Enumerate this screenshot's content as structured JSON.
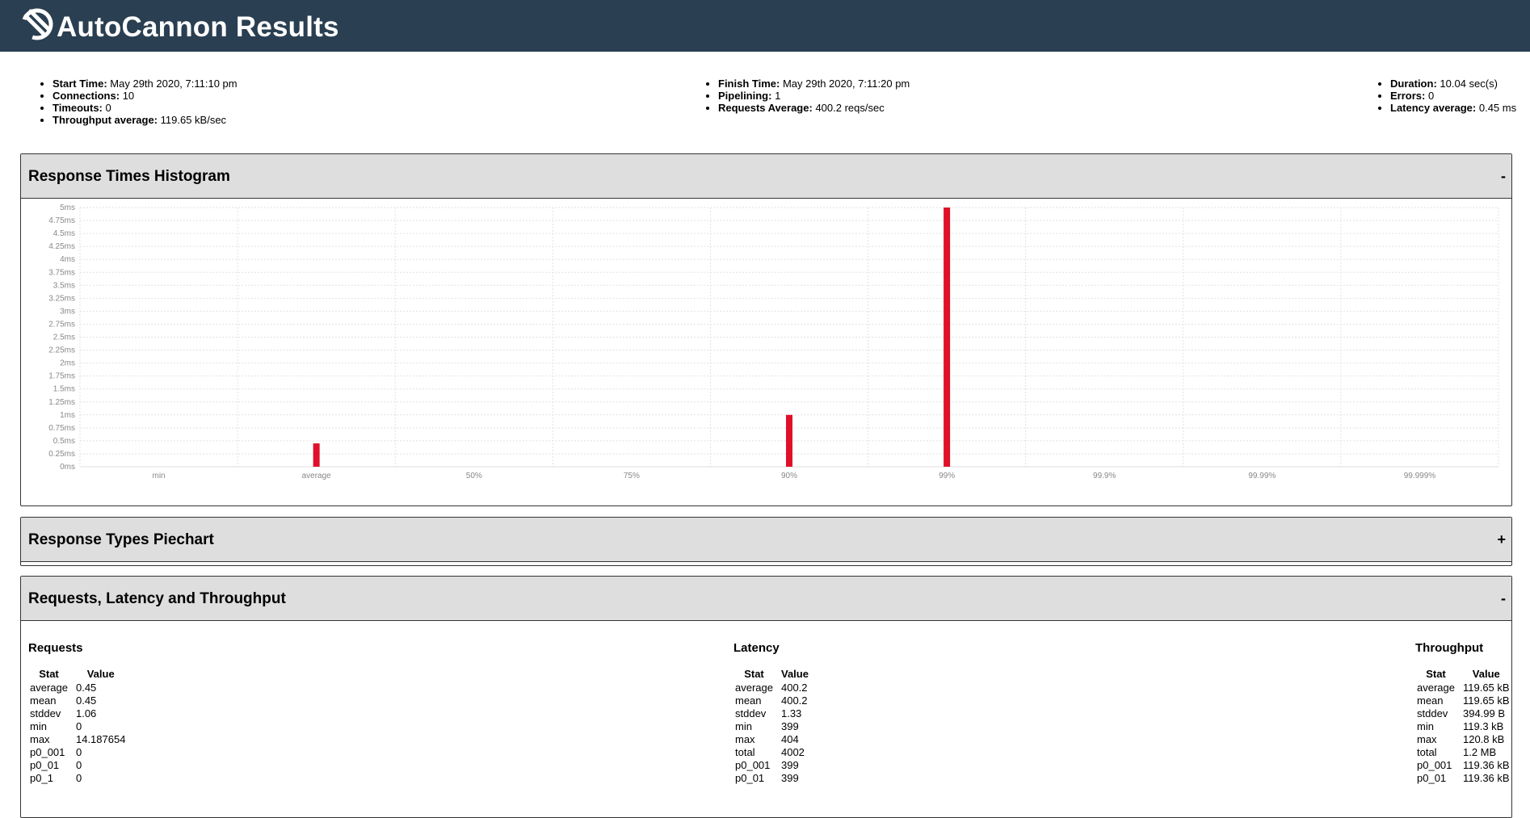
{
  "header": {
    "title": "AutoCannon Results"
  },
  "summary": {
    "col1": [
      {
        "label": "Start Time:",
        "value": "May 29th 2020, 7:11:10 pm"
      },
      {
        "label": "Connections:",
        "value": "10"
      },
      {
        "label": "Timeouts:",
        "value": "0"
      },
      {
        "label": "Throughput average:",
        "value": "119.65 kB/sec"
      }
    ],
    "col2": [
      {
        "label": "Finish Time:",
        "value": "May 29th 2020, 7:11:20 pm"
      },
      {
        "label": "Pipelining:",
        "value": "1"
      },
      {
        "label": "Requests Average:",
        "value": "400.2 reqs/sec"
      }
    ],
    "col3": [
      {
        "label": "Duration:",
        "value": "10.04 sec(s)"
      },
      {
        "label": "Errors:",
        "value": "0"
      },
      {
        "label": "Latency average:",
        "value": "0.45 ms"
      }
    ]
  },
  "panels": {
    "histogram": {
      "title": "Response Times Histogram",
      "toggle": "-"
    },
    "piechart": {
      "title": "Response Types Piechart",
      "toggle": "+"
    },
    "stats": {
      "title": "Requests, Latency and Throughput",
      "toggle": "-"
    }
  },
  "chart_data": {
    "type": "bar",
    "categories": [
      "min",
      "average",
      "50%",
      "75%",
      "90%",
      "99%",
      "99.9%",
      "99.99%",
      "99.999%"
    ],
    "values": [
      0,
      0.45,
      0,
      0,
      1,
      5,
      0,
      0,
      0
    ],
    "yticks": [
      "0ms",
      "0.25ms",
      "0.5ms",
      "0.75ms",
      "1ms",
      "1.25ms",
      "1.5ms",
      "1.75ms",
      "2ms",
      "2.25ms",
      "2.5ms",
      "2.75ms",
      "3ms",
      "3.25ms",
      "3.5ms",
      "3.75ms",
      "4ms",
      "4.25ms",
      "4.5ms",
      "4.75ms",
      "5ms"
    ],
    "ylim": [
      0,
      5
    ],
    "color": "#e0102a",
    "grid": true
  },
  "stats": {
    "header": {
      "stat": "Stat",
      "value": "Value"
    },
    "requests": {
      "title": "Requests",
      "rows": [
        [
          "average",
          "0.45"
        ],
        [
          "mean",
          "0.45"
        ],
        [
          "stddev",
          "1.06"
        ],
        [
          "min",
          "0"
        ],
        [
          "max",
          "14.187654"
        ],
        [
          "p0_001",
          "0"
        ],
        [
          "p0_01",
          "0"
        ],
        [
          "p0_1",
          "0"
        ]
      ]
    },
    "latency": {
      "title": "Latency",
      "rows": [
        [
          "average",
          "400.2"
        ],
        [
          "mean",
          "400.2"
        ],
        [
          "stddev",
          "1.33"
        ],
        [
          "min",
          "399"
        ],
        [
          "max",
          "404"
        ],
        [
          "total",
          "4002"
        ],
        [
          "p0_001",
          "399"
        ],
        [
          "p0_01",
          "399"
        ]
      ]
    },
    "throughput": {
      "title": "Throughput",
      "rows": [
        [
          "average",
          "119.65 kB"
        ],
        [
          "mean",
          "119.65 kB"
        ],
        [
          "stddev",
          "394.99 B"
        ],
        [
          "min",
          "119.3 kB"
        ],
        [
          "max",
          "120.8 kB"
        ],
        [
          "total",
          "1.2 MB"
        ],
        [
          "p0_001",
          "119.36 kB"
        ],
        [
          "p0_01",
          "119.36 kB"
        ]
      ]
    }
  }
}
